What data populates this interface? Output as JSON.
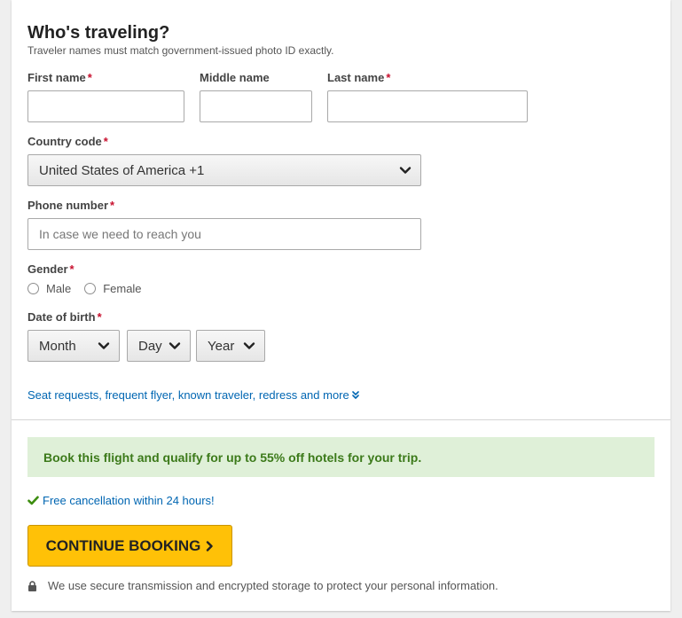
{
  "form": {
    "title": "Who's traveling?",
    "subtitle": "Traveler names must match government-issued photo ID exactly.",
    "required_marker": "*",
    "first_name": {
      "label": "First name",
      "value": ""
    },
    "middle_name": {
      "label": "Middle name",
      "value": ""
    },
    "last_name": {
      "label": "Last name",
      "value": ""
    },
    "country_code": {
      "label": "Country code",
      "selected": "United States of America +1"
    },
    "phone": {
      "label": "Phone number",
      "placeholder": "In case we need to reach you",
      "value": ""
    },
    "gender": {
      "label": "Gender",
      "options": [
        "Male",
        "Female"
      ],
      "selected": null
    },
    "dob": {
      "label": "Date of birth",
      "month": "Month",
      "day": "Day",
      "year": "Year"
    },
    "more_link": "Seat requests, frequent flyer, known traveler, redress and more",
    "more_link_icon": "double-chevron-down-icon"
  },
  "footer": {
    "promo": "Book this flight and qualify for up to 55% off hotels for your trip.",
    "cancellation": "Free cancellation within 24 hours!",
    "cancellation_icon": "checkmark-icon",
    "cta_label": "CONTINUE BOOKING",
    "cta_icon": "chevron-right-icon",
    "secure_text": "We use secure transmission and encrypted storage to protect your personal information.",
    "secure_icon": "lock-icon"
  },
  "colors": {
    "cta_bg": "#ffc107",
    "link": "#0066b2",
    "promo_bg": "#dff0d8",
    "promo_text": "#3c7a1a",
    "required": "#c8102e",
    "check": "#3c8d0f"
  }
}
